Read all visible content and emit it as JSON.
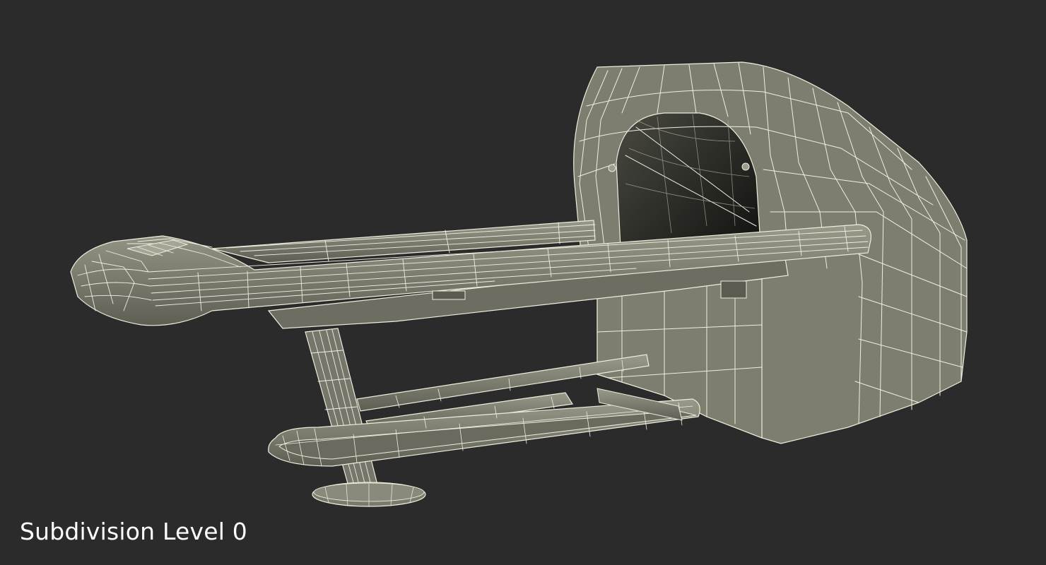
{
  "viewport": {
    "caption": "Subdivision Level 0",
    "background_color": "#2b2b2b",
    "mesh_color": "#7d7d70",
    "wire_color": "#f1efe2"
  },
  "model": {
    "name": "pet-ct-scanner-wireframe"
  }
}
